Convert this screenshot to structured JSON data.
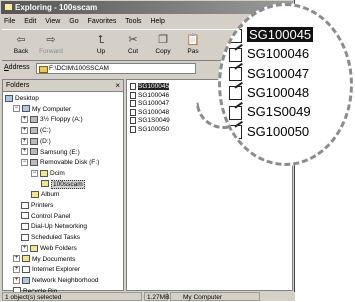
{
  "window": {
    "title": "Exploring - 100sscam"
  },
  "menu": [
    "File",
    "Edit",
    "View",
    "Go",
    "Favorites",
    "Tools",
    "Help"
  ],
  "toolbar": [
    {
      "label": "Back",
      "icon": "back-arrow-icon",
      "glyph": "⇦",
      "enabled": true
    },
    {
      "label": "Forward",
      "icon": "forward-arrow-icon",
      "glyph": "⇨",
      "enabled": false
    },
    {
      "label": "Up",
      "icon": "up-folder-icon",
      "glyph": "⮤",
      "enabled": true
    },
    {
      "label": "Cut",
      "icon": "scissors-icon",
      "glyph": "✂",
      "enabled": true
    },
    {
      "label": "Copy",
      "icon": "copy-icon",
      "glyph": "❐",
      "enabled": true
    },
    {
      "label": "Pas",
      "icon": "paste-icon",
      "glyph": "📋",
      "enabled": true
    }
  ],
  "address": {
    "label": "Address",
    "value": "F:\\DCIM\\100SSCAM"
  },
  "folders_pane": {
    "title": "Folders",
    "close_glyph": "×",
    "tree": [
      {
        "label": "Desktop",
        "icon": "desktop-icon",
        "expander": ""
      },
      {
        "label": "My Computer",
        "icon": "computer-icon",
        "expander": "−"
      },
      {
        "label": "3½ Floppy (A:)",
        "icon": "floppy-icon",
        "expander": "+"
      },
      {
        "label": "(C:)",
        "icon": "drive-icon",
        "expander": "+"
      },
      {
        "label": "(D:)",
        "icon": "drive-icon",
        "expander": "+"
      },
      {
        "label": "Samsung (E:)",
        "icon": "cd-drive-icon",
        "expander": "+"
      },
      {
        "label": "Removable Disk (F:)",
        "icon": "removable-disk-icon",
        "expander": "−"
      },
      {
        "label": "Dcim",
        "icon": "folder-icon",
        "expander": "−"
      },
      {
        "label": "100sscam",
        "icon": "open-folder-icon",
        "expander": "",
        "selected": true
      },
      {
        "label": "Album",
        "icon": "folder-icon",
        "expander": ""
      },
      {
        "label": "Printers",
        "icon": "printer-icon",
        "expander": ""
      },
      {
        "label": "Control Panel",
        "icon": "control-panel-icon",
        "expander": ""
      },
      {
        "label": "Dial-Up Networking",
        "icon": "dialup-icon",
        "expander": ""
      },
      {
        "label": "Scheduled Tasks",
        "icon": "scheduled-tasks-icon",
        "expander": ""
      },
      {
        "label": "Web Folders",
        "icon": "web-folder-icon",
        "expander": "+"
      },
      {
        "label": "My Documents",
        "icon": "folder-icon",
        "expander": "+"
      },
      {
        "label": "Internet Explorer",
        "icon": "ie-icon",
        "expander": "+"
      },
      {
        "label": "Network Neighborhood",
        "icon": "network-icon",
        "expander": "+"
      },
      {
        "label": "Recycle Bin",
        "icon": "recycle-bin-icon",
        "expander": ""
      }
    ]
  },
  "files": [
    {
      "name": "SG100045",
      "selected": true
    },
    {
      "name": "SG100046",
      "selected": false
    },
    {
      "name": "SG100047",
      "selected": false
    },
    {
      "name": "SG100048",
      "selected": false
    },
    {
      "name": "SG1S0049",
      "selected": false
    },
    {
      "name": "SG100050",
      "selected": false
    }
  ],
  "status": {
    "left": "1 object(s) selected",
    "size": "1.27MB",
    "location": "My Computer"
  }
}
